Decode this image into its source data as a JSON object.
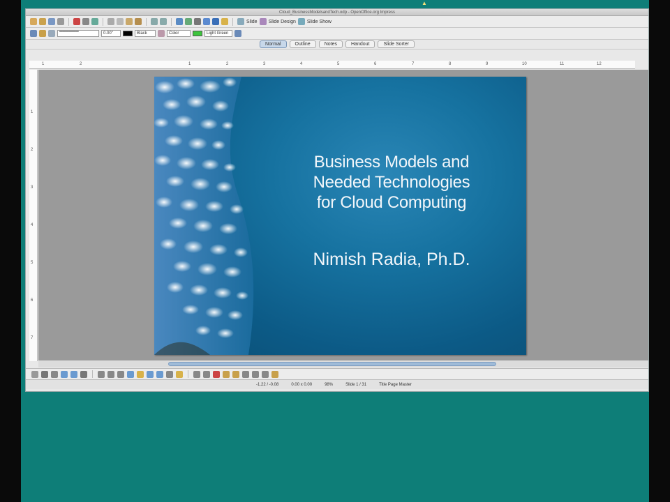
{
  "window": {
    "title": "Cloud_BusinessModelsandTech.odp - OpenOffice.org Impress"
  },
  "toolbar1": {
    "slide_label": "Slide",
    "slide_design_label": "Slide Design",
    "slide_show_label": "Slide Show"
  },
  "toolbar2": {
    "line_width": "0.00\"",
    "line_color_name": "Black",
    "area_style": "Color",
    "area_color_name": "Light Green"
  },
  "view_tabs": [
    "Normal",
    "Outline",
    "Notes",
    "Handout",
    "Slide Sorter"
  ],
  "ruler": {
    "h_ticks": [
      "1",
      "2",
      "1",
      "2",
      "3",
      "4",
      "5",
      "6",
      "7",
      "8",
      "9",
      "10",
      "11",
      "12"
    ],
    "v_ticks": [
      "1",
      "2",
      "3",
      "4",
      "5",
      "6",
      "7"
    ]
  },
  "slide": {
    "title_lines": [
      "Business Models and",
      "Needed Technologies",
      "for Cloud Computing"
    ],
    "author": "Nimish Radia, Ph.D."
  },
  "status": {
    "position": "-1.22 / -0.08",
    "size": "0.00 x 0.00",
    "zoom": "98%",
    "slide_indicator": "Slide 1 / 31",
    "master": "Title Page Master"
  },
  "colors": {
    "desktop": "#0e7e78",
    "slide_bg": "#1672a0",
    "accent_green": "#3cc43c"
  }
}
